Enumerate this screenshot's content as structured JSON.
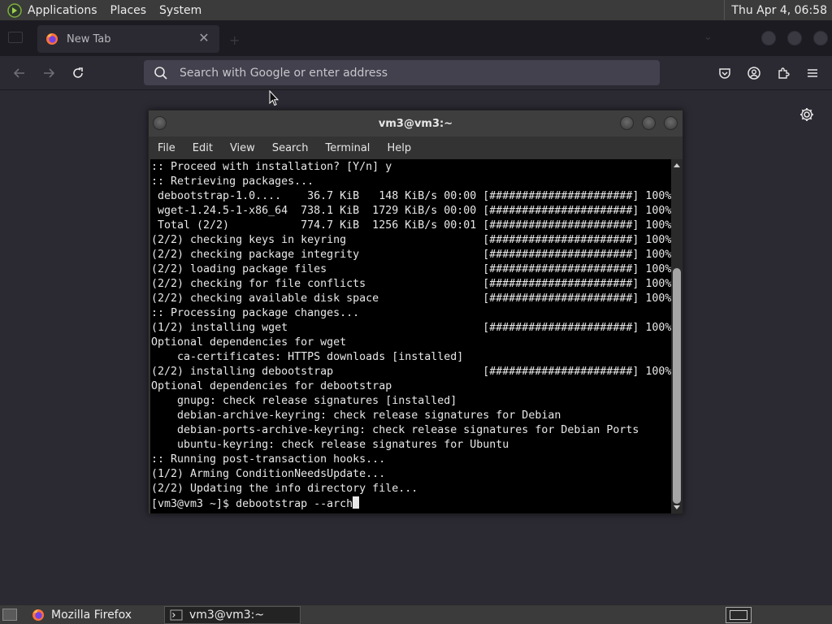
{
  "top_panel": {
    "menus": [
      "Applications",
      "Places",
      "System"
    ],
    "clock": "Thu Apr  4, 06:58"
  },
  "browser": {
    "tab_title": "New Tab",
    "urlbar_placeholder": "Search with Google or enter address"
  },
  "terminal": {
    "title": "vm3@vm3:~",
    "menu": [
      "File",
      "Edit",
      "View",
      "Search",
      "Terminal",
      "Help"
    ],
    "lines": [
      ":: Proceed with installation? [Y/n] y",
      ":: Retrieving packages...",
      " debootstrap-1.0....    36.7 KiB   148 KiB/s 00:00 [######################] 100%",
      " wget-1.24.5-1-x86_64  738.1 KiB  1729 KiB/s 00:00 [######################] 100%",
      " Total (2/2)           774.7 KiB  1256 KiB/s 00:01 [######################] 100%",
      "(2/2) checking keys in keyring                     [######################] 100%",
      "(2/2) checking package integrity                   [######################] 100%",
      "(2/2) loading package files                        [######################] 100%",
      "(2/2) checking for file conflicts                  [######################] 100%",
      "(2/2) checking available disk space                [######################] 100%",
      ":: Processing package changes...",
      "(1/2) installing wget                              [######################] 100%",
      "Optional dependencies for wget",
      "    ca-certificates: HTTPS downloads [installed]",
      "(2/2) installing debootstrap                       [######################] 100%",
      "Optional dependencies for debootstrap",
      "    gnupg: check release signatures [installed]",
      "    debian-archive-keyring: check release signatures for Debian",
      "    debian-ports-archive-keyring: check release signatures for Debian Ports",
      "    ubuntu-keyring: check release signatures for Ubuntu",
      ":: Running post-transaction hooks...",
      "(1/2) Arming ConditionNeedsUpdate...",
      "(2/2) Updating the info directory file..."
    ],
    "prompt": "[vm3@vm3 ~]$ debootstrap --arch"
  },
  "taskbar": {
    "items": [
      "Mozilla Firefox",
      "vm3@vm3:~"
    ]
  },
  "colors": {
    "panel": "#3a3b3a",
    "firefox_bg": "#2b2a33",
    "terminal_bg": "#000000",
    "terminal_fg": "#e8e8e8"
  }
}
